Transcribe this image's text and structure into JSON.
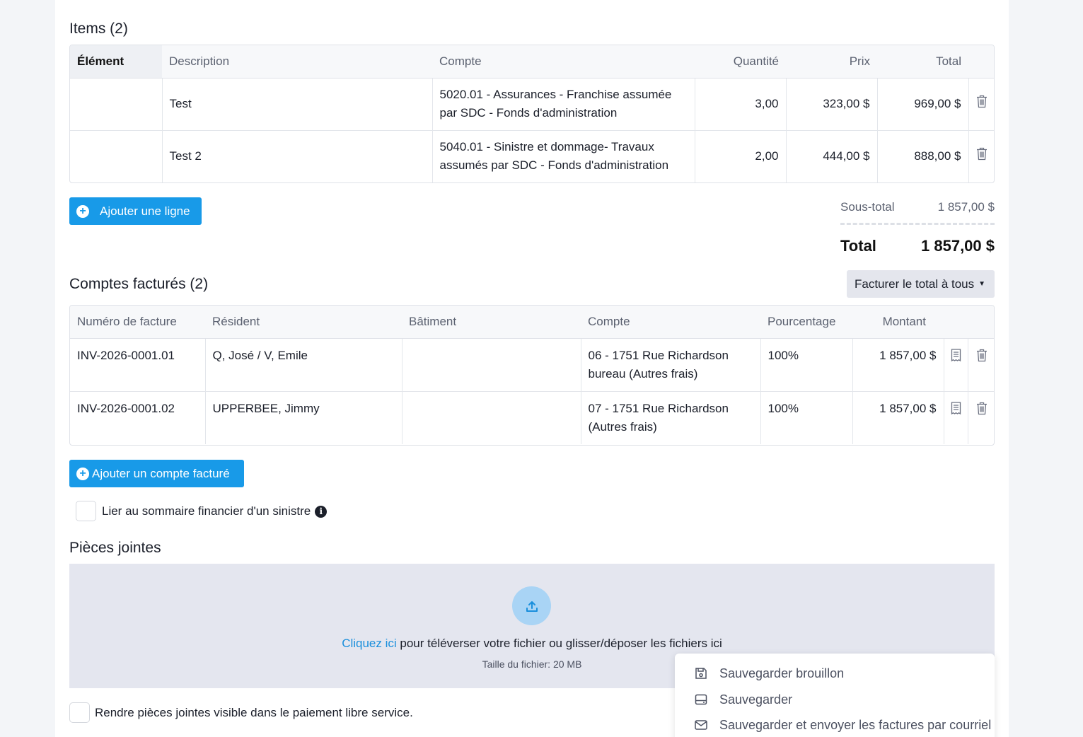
{
  "items_section": {
    "title": "Items (2)",
    "headers": [
      "Élément",
      "Description",
      "Compte",
      "Quantité",
      "Prix",
      "Total"
    ],
    "rows": [
      {
        "element": "",
        "description": "Test",
        "compte_line1": "5020.01 - Assurances - Franchise assumée",
        "compte_line2": "par SDC - Fonds d'administration",
        "quantite": "3,00",
        "prix": "323,00 $",
        "total": "969,00 $"
      },
      {
        "element": "",
        "description": "Test 2",
        "compte_line1": "5040.01 - Sinistre et dommage- Travaux",
        "compte_line2": "assumés par SDC - Fonds d'administration",
        "quantite": "2,00",
        "prix": "444,00 $",
        "total": "888,00 $"
      }
    ],
    "add_line_label": "Ajouter une ligne",
    "subtotal_label": "Sous-total",
    "subtotal_value": "1 857,00 $",
    "total_label": "Total",
    "total_value": "1 857,00 $"
  },
  "billed_section": {
    "title": "Comptes facturés (2)",
    "bill_all_label": "Facturer le total à tous",
    "headers": [
      "Numéro de facture",
      "Résident",
      "Bâtiment",
      "Compte",
      "Pourcentage",
      "Montant"
    ],
    "rows": [
      {
        "invoice": "INV-2026-0001.01",
        "resident": "Q, José / V, Emile",
        "batiment": "",
        "compte_line1": "06 - 1751 Rue Richardson",
        "compte_line2": "bureau (Autres frais)",
        "pourcentage": "100%",
        "montant": "1 857,00 $"
      },
      {
        "invoice": "INV-2026-0001.02",
        "resident": "UPPERBEE, Jimmy",
        "batiment": "",
        "compte_line1": "07 - 1751 Rue Richardson",
        "compte_line2": "(Autres frais)",
        "pourcentage": "100%",
        "montant": "1 857,00 $"
      }
    ],
    "add_account_label": "Ajouter un compte facturé",
    "link_claim_label": "Lier au sommaire financier d'un sinistre"
  },
  "attachments": {
    "title": "Pièces jointes",
    "click_here": "Cliquez ici",
    "upload_text": " pour téléverser votre fichier ou glisser/déposer les fichiers ici",
    "size_text": "Taille du fichier: 20 MB",
    "visible_label": "Rendre pièces jointes visible dans le paiement libre service."
  },
  "save_menu": {
    "items": [
      {
        "label": "Sauvegarder brouillon",
        "icon": "floppy-icon"
      },
      {
        "label": "Sauvegarder",
        "icon": "drive-icon"
      },
      {
        "label": "Sauvegarder et envoyer les factures par courriel",
        "icon": "envelope-icon"
      }
    ]
  },
  "colors": {
    "accent": "#189ae8",
    "dropzone": "#e4e6ef",
    "upload_circle": "#a9d4f5"
  }
}
